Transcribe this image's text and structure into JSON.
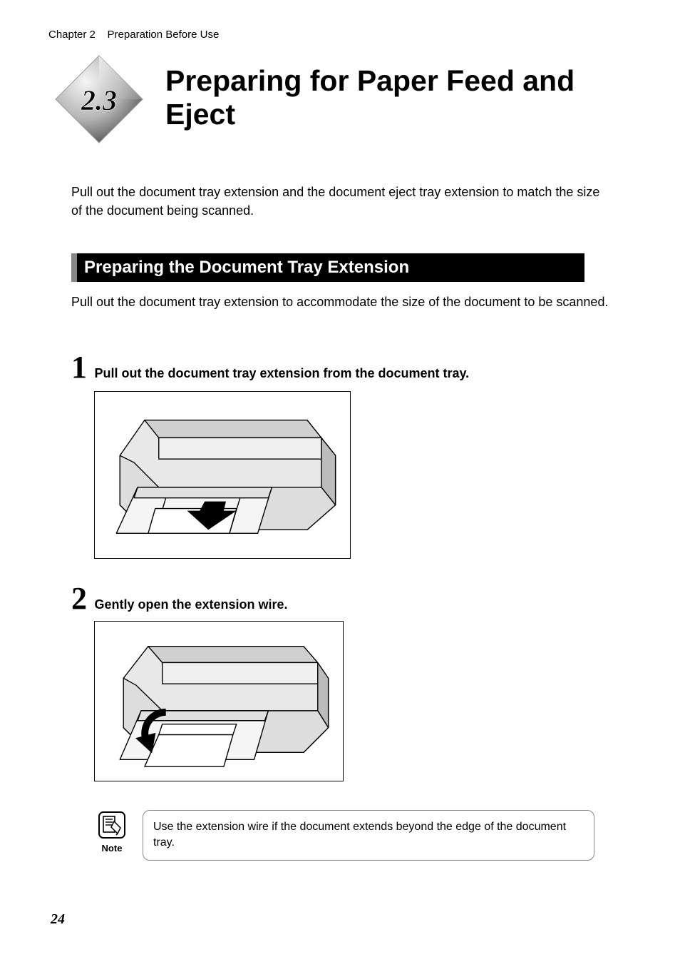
{
  "header": {
    "chapter_label": "Chapter 2",
    "chapter_title": "Preparation Before Use"
  },
  "section": {
    "number": "2.3",
    "title": "Preparing for Paper Feed and Eject"
  },
  "intro": "Pull out the document tray extension and the document eject tray extension to match the size of the document being scanned.",
  "subsection": {
    "title": "Preparing the Document Tray Extension",
    "desc": "Pull out the document tray extension to accommodate the size of the document to be scanned."
  },
  "steps": [
    {
      "num": "1",
      "text": "Pull out the document tray extension from the document tray."
    },
    {
      "num": "2",
      "text": "Gently open the extension wire."
    }
  ],
  "note": {
    "label": "Note",
    "text": "Use the extension wire if the document extends beyond the edge of the document tray."
  },
  "page_number": "24"
}
